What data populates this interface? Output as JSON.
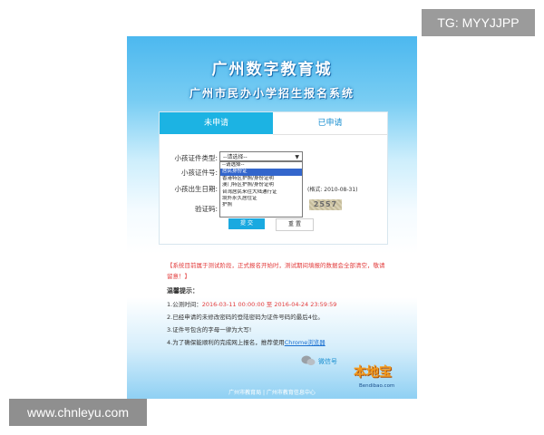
{
  "watermark_top": "TG: MYYJJPP",
  "watermark_bottom": "www.chnleyu.com",
  "header": {
    "title": "广州数字教育城",
    "subtitle": "广州市民办小学招生报名系统"
  },
  "tabs": [
    {
      "label": "未申请",
      "active": true
    },
    {
      "label": "已申请",
      "active": false
    }
  ],
  "form": {
    "id_type_label": "小孩证件类型:",
    "id_type_selected": "--请选择--",
    "id_type_options": [
      "--请选择--",
      "居民身份证",
      "香港特区护照/身份证明",
      "澳门特区护照/身份证明",
      "台湾居民来往大陆通行证",
      "境外永久居住证",
      "护照"
    ],
    "highlighted_option": "居民身份证",
    "id_number_label": "小孩证件号:",
    "birth_label": "小孩出生日期:",
    "birth_hint": "(格式: 2010-08-31)",
    "captcha_label": "验证码:",
    "captcha_text": "2557",
    "submit_label": "提 交",
    "reset_label": "重 置"
  },
  "notice": "【系统目前属于测试阶段，正式报名开始时，测试期间填报的数据会全部清空，敬请留意！】",
  "tips": {
    "heading": "温馨提示：",
    "line1_prefix": "1.公测时间：",
    "line1_time": "2016-03-11 00:00:00 至 2016-04-24 23:59:59",
    "line2": "2.已经申请的未修改密码的登陆密码为证件号码的最后4位。",
    "line3": "3.证件号包含的字母一律为大写!",
    "line4_prefix": "4.为了确保能顺利的完成网上报名，推荐使用",
    "line4_link": "Chrome浏览器"
  },
  "footer": "广州市教育局 | 广州市教育信息中心",
  "logo": {
    "sub": "微信号",
    "main": "本地宝",
    "url": "Bendibao.com"
  },
  "colors": {
    "accent": "#1cb3e3",
    "notice": "#e23c3c",
    "link": "#1a6fd0"
  }
}
